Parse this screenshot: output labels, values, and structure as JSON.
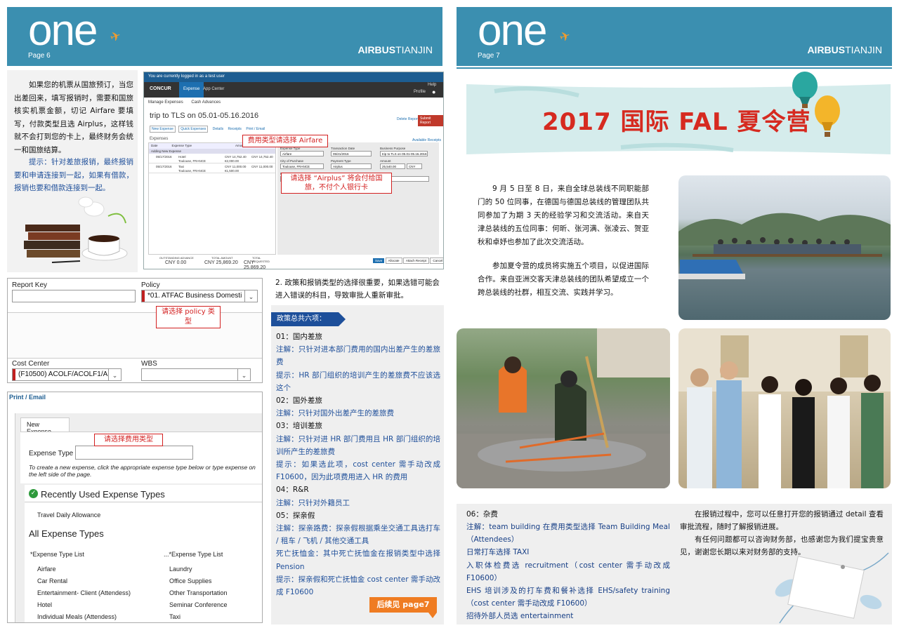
{
  "left_header": {
    "logo": "one",
    "page": "Page 6",
    "brand_bold": "AIRBUS",
    "brand_rest": "TIANJIN"
  },
  "right_header": {
    "logo": "one",
    "page": "Page 7",
    "brand_bold": "AIRBUS",
    "brand_rest": "TIANJIN"
  },
  "intro": {
    "para1": "如果您的机票从国旅预订，当您出差回来，填写报销时，需要和国旅核实机票金额，切记 Airfare 要填写，付款类型且选 Airplus，这样钱就不会打到您的卡上，最终财务会统一和国旅结算。",
    "para2": "提示：针对差旅报销，最终报销要和申请连接到一起，如果有借款，报销也要和借款连接到一起。"
  },
  "concur": {
    "banner": "You are currently logged in as a test user",
    "help": "Help",
    "logo": "CONCUR",
    "nav": [
      "Expense",
      "App Center"
    ],
    "profile": "Profile",
    "subnav": [
      "Manage Expenses",
      "Cash Advances"
    ],
    "title": "trip to TLS on 05.01-05.16.2016",
    "delete_report": "Delete Report",
    "submit_report": "Submit Report",
    "actions": [
      "New Expense",
      "Quick Expenses",
      "Details",
      "Receipts",
      "Print / Email"
    ],
    "expenses_label": "Expenses",
    "available_receipts": "Available Receipts",
    "col_date": "Date",
    "col_type": "Expense Type",
    "col_amount": "Amount",
    "adding_new": "Adding New Expense",
    "rows": [
      {
        "date": "05/17/2016",
        "type": "Hotel",
        "loc": "Toulouse, FRANCE",
        "amt1": "CNY 14,752.40",
        "amt2": "€2,000.00",
        "amt3": "CNY 14,752.40"
      },
      {
        "date": "05/17/2016",
        "type": "Taxi",
        "loc": "Toulouse, FRANCE",
        "amt1": "CNY 11,000.00",
        "amt2": "€1,500.00",
        "amt3": "CNY 11,000.00"
      }
    ],
    "form": {
      "expense_type_label": "Expense Type",
      "expense_type": "Airfare",
      "transaction_date_label": "Transaction Date",
      "transaction_date": "05/21/2016",
      "business_purpose_label": "Business Purpose",
      "business_purpose": "trip to TLS on 05.01-05.16.2016",
      "city_label": "City of Purchase",
      "city": "Toulouse, FRANCE",
      "payment_label": "Payment Type",
      "payment": "Airplus",
      "amount_label": "Amount",
      "amount": "25,540.00",
      "currency": "CNY",
      "request_status": "Request Status"
    },
    "footer": {
      "outstanding_label": "OUTSTANDING ADVANCE",
      "outstanding": "CNY 0.00",
      "total_amount_label": "TOTAL AMOUNT",
      "total_amount": "CNY 25,869.20",
      "total_requested_label": "TOTAL REQUESTED",
      "total_requested": "CNY 25,869.20"
    },
    "buttons": [
      "Save",
      "Allocate",
      "Attach Receipt",
      "Cancel"
    ],
    "callout_airfare": "费用类型请选择 Airfare",
    "callout_airplus": "请选择 “Airplus” 将会付给国旅，不付个人银行卡"
  },
  "policy_form": {
    "report_key_label": "Report Key",
    "policy_label": "Policy",
    "policy_value": "*01. ATFAC Business Domesti",
    "policy_callout": "请选择 policy 类型",
    "cost_center_label": "Cost Center",
    "cost_center_value": "(F10500)  ACOLF/ACOLF1/A",
    "wbs_label": "WBS"
  },
  "new_expense": {
    "print_email": "Print / Email",
    "tab": "New Expense",
    "expense_type_label": "Expense Type",
    "callout": "请选择费用类型",
    "instruction": "To create a new expense, click the appropriate expense type below or type expense on the left side of the page.",
    "recent_heading": "Recently Used Expense Types",
    "recent_items": [
      "Travel Daily Allowance"
    ],
    "all_heading": "All Expense Types",
    "col1_header": "*Expense Type List",
    "col2_header": "...*Expense Type List",
    "col1": [
      "Airfare",
      "Car Rental",
      "Entertainment- Client (Attendess)",
      "Hotel",
      "Individual Meals (Attendess)"
    ],
    "col2": [
      "Laundry",
      "Office Supplies",
      "Other Transportation",
      "Seminar Conference",
      "Taxi"
    ]
  },
  "policy_notes": {
    "intro": "2. 政策和报销类型的选择很重要，如果选错可能会进入错误的科目，导致审批人重新审批。",
    "badge": "政策总共六项：",
    "lines": [
      {
        "text": "01：国内差旅",
        "style": "dark"
      },
      {
        "text": "注解：只针对进本部门费用的国内出差产生的差旅费",
        "style": "blue"
      },
      {
        "text": "提示：HR 部门组织的培训产生的差旅费不应该选这个",
        "style": "blue"
      },
      {
        "text": "02：国外差旅",
        "style": "dark"
      },
      {
        "text": "注解：只针对国外出差产生的差旅费",
        "style": "blue"
      },
      {
        "text": "03：培训差旅",
        "style": "dark"
      },
      {
        "text": "注解：只针对进 HR 部门费用且 HR 部门组织的培训所产生的差旅费",
        "style": "blue"
      },
      {
        "text": "提示：如果选此项，cost center 需手动改成 F10600，因为此项费用进入 HR 的费用",
        "style": "blue"
      },
      {
        "text": "04：R&R",
        "style": "dark"
      },
      {
        "text": "注解：只针对外籍员工",
        "style": "blue"
      },
      {
        "text": "05：探亲假",
        "style": "dark"
      },
      {
        "text": "注解：探亲路费：探亲假根据乘坐交通工具选打车 / 租车 / 飞机 / 其他交通工具",
        "style": "blue"
      },
      {
        "text": "死亡抚恤金：其中死亡抚恤金在报销类型中选择 Pension",
        "style": "blue"
      },
      {
        "text": "提示：探亲假和死亡抚恤金 cost center 需手动改成 F10600",
        "style": "blue"
      }
    ],
    "continued": "后续见 page7"
  },
  "camp": {
    "title": "2017 国际 FAL 夏令营",
    "para1": "9 月 5 日至 8 日，来自全球总装线不同职能部门的 50 位同事，在德国与德国总装线的管理团队共同参加了为期 3 天的经验学习和交流活动。来自天津总装线的五位同事：何昕、张河满、张凌云、贺亚秋和卓妤也参加了此次交流活动。",
    "para2": "参加夏令营的成员将实施五个项目，以促进国际合作。来自亚洲交客天津总装线的团队希望成立一个跨总装线的社群，相互交流、实践并学习。"
  },
  "misc": {
    "heading": "06：杂费",
    "lines": [
      "注解：team building 在费用类型选择 Team Building Meal（Attendees）",
      "日常打车选择 TAXI",
      "入职体检费选 recruitment（cost center 需手动改成 F10600）",
      "EHS 培训涉及的打车费和餐补选择 EHS/safety training（cost center 需手动改成 F10600）",
      "招待外部人员选 entertainment"
    ],
    "closing1": "在报销过程中，您可以任意打开您的报销通过 detail 查看审批流程，随时了解报销进展。",
    "closing2": "有任何问题都可以咨询财务部，也感谢您为我们提宝贵意见，谢谢您长期以来对财务部的支持。"
  },
  "colors": {
    "header": "#3b8fb0",
    "accent": "#f39c2b",
    "navy": "#173f86",
    "red": "#d32020"
  }
}
